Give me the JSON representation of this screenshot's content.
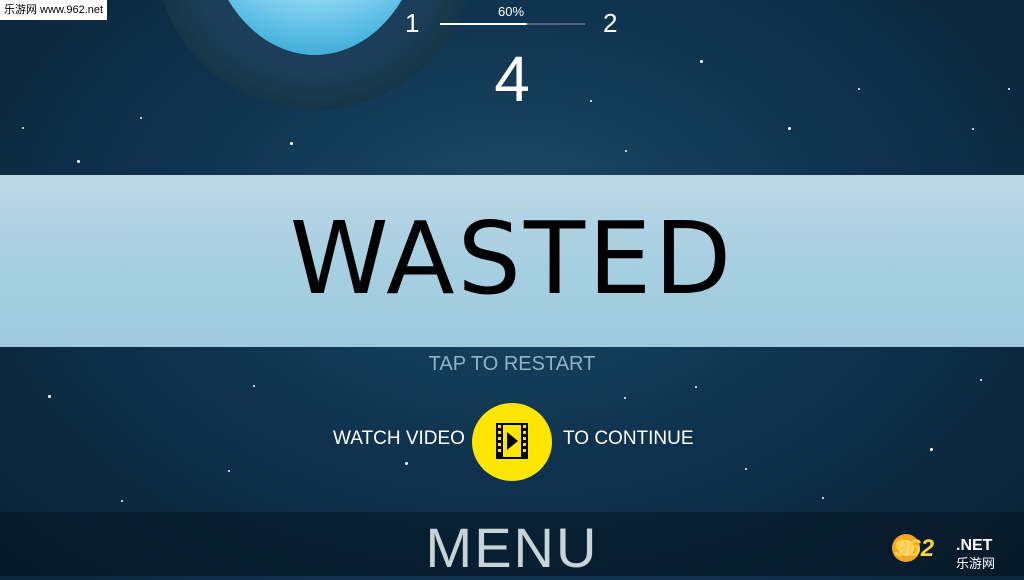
{
  "watermark": {
    "text": "乐游网 www.962.net"
  },
  "hud": {
    "level_current": "1",
    "level_next": "2",
    "progress_label": "60%",
    "progress_value": 0.6,
    "score": "4"
  },
  "overlay": {
    "title": "WASTED",
    "tap_text": "TAP TO RESTART",
    "watch_label": "WATCH VIDEO",
    "continue_label": "TO CONTINUE",
    "video_icon": "film-play-icon",
    "menu_label": "MENU"
  },
  "colors": {
    "accent_yellow": "#ffe600",
    "band": "#a7cfe2",
    "background": "#0f3450"
  },
  "logo": {
    "text": "962 NET 乐游网"
  }
}
